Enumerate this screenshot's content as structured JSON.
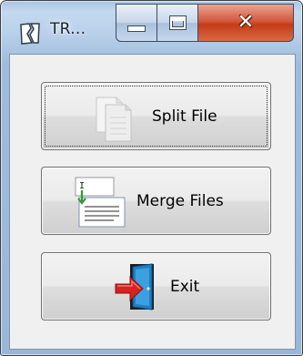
{
  "window": {
    "title": "TR...",
    "app_icon": "app-icon",
    "minimize_icon": "minimize-icon",
    "maximize_icon": "maximize-icon",
    "close_icon": "close-icon"
  },
  "buttons": [
    {
      "label": "Split File",
      "icon": "split-file-icon"
    },
    {
      "label": "Merge Files",
      "icon": "merge-files-icon"
    },
    {
      "label": "Exit",
      "icon": "exit-door-icon"
    }
  ],
  "colors": {
    "frame": "#a9c4e0",
    "close": "#c43b17",
    "button_face": "#e6e6e6",
    "arrow_green": "#2f9a2f",
    "arrow_red": "#d8221e",
    "door_blue": "#1f7fc4"
  }
}
